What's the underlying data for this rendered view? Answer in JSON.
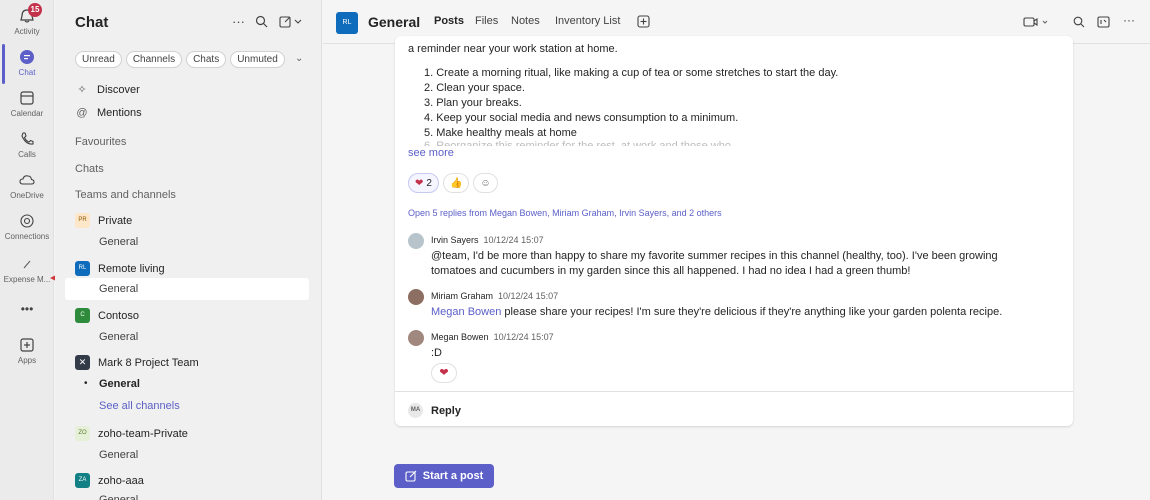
{
  "rail": {
    "activity_badge": "15",
    "items": [
      {
        "label": "Activity",
        "icon": "bell-icon"
      },
      {
        "label": "Chat",
        "icon": "chat-icon"
      },
      {
        "label": "Calendar",
        "icon": "calendar-icon"
      },
      {
        "label": "Calls",
        "icon": "phone-icon"
      },
      {
        "label": "OneDrive",
        "icon": "cloud-icon"
      },
      {
        "label": "Connections",
        "icon": "connections-icon"
      },
      {
        "label": "Expense M...",
        "icon": "pen-icon"
      },
      {
        "label": "Apps",
        "icon": "plus-box-icon"
      }
    ],
    "more": "•••"
  },
  "chat_pane": {
    "title": "Chat",
    "filters": [
      "Unread",
      "Channels",
      "Chats",
      "Unmuted"
    ],
    "discover": "Discover",
    "mentions": "Mentions",
    "favourites": "Favourites",
    "chats": "Chats",
    "teams_and_channels": "Teams and channels",
    "teams": [
      {
        "name": "Private",
        "initials": "PR",
        "channels": [
          "General"
        ]
      },
      {
        "name": "Remote living",
        "initials": "RL",
        "channels": [
          "General"
        ]
      },
      {
        "name": "Contoso",
        "initials": "C",
        "channels": [
          "General"
        ]
      },
      {
        "name": "Mark 8 Project Team",
        "initials": "M8",
        "channels": [
          "General"
        ],
        "see_all": "See all channels"
      },
      {
        "name": "zoho-team-Private",
        "initials": "ZO",
        "channels": [
          "General"
        ]
      },
      {
        "name": "zoho-aaa",
        "initials": "ZA",
        "channels": [
          "General"
        ]
      }
    ]
  },
  "header": {
    "avatar_initials": "RL",
    "channel": "General",
    "tabs": [
      "Posts",
      "Files",
      "Notes",
      "Inventory List"
    ]
  },
  "post": {
    "intro": "a reminder near your work station at home.",
    "list": [
      "1. Create a morning ritual, like making a cup of tea or some stretches to start the day.",
      "2. Clean your space.",
      "3. Plan your breaks.",
      "4. Keep your social media and news consumption to a minimum.",
      "5. Make healthy meals at home"
    ],
    "list_faded": "6. Reorganize this reminder for the rest, at work and those who ...",
    "see_more": "see more",
    "reaction_heart_count": "2",
    "replies_link": "Open 5 replies from Megan Bowen, Miriam Graham, Irvin Sayers, and 2 others"
  },
  "replies": [
    {
      "name": "Irvin Sayers",
      "time": "10/12/24 15:07",
      "text": "@team, I'd be more than happy to share my favorite summer recipes in this channel (healthy, too). I've been growing tomatoes and cucumbers in my garden since this all happened. I had no idea I had a green thumb!"
    },
    {
      "name": "Miriam Graham",
      "time": "10/12/24 15:07",
      "mention": "Megan Bowen",
      "text": " please share your recipes! I'm sure they're delicious if they're anything like your garden polenta recipe."
    },
    {
      "name": "Megan Bowen",
      "time": "10/12/24 15:07",
      "text": ":D"
    }
  ],
  "reply_box": {
    "avatar": "MA",
    "label": "Reply"
  },
  "start_post": "Start a post"
}
